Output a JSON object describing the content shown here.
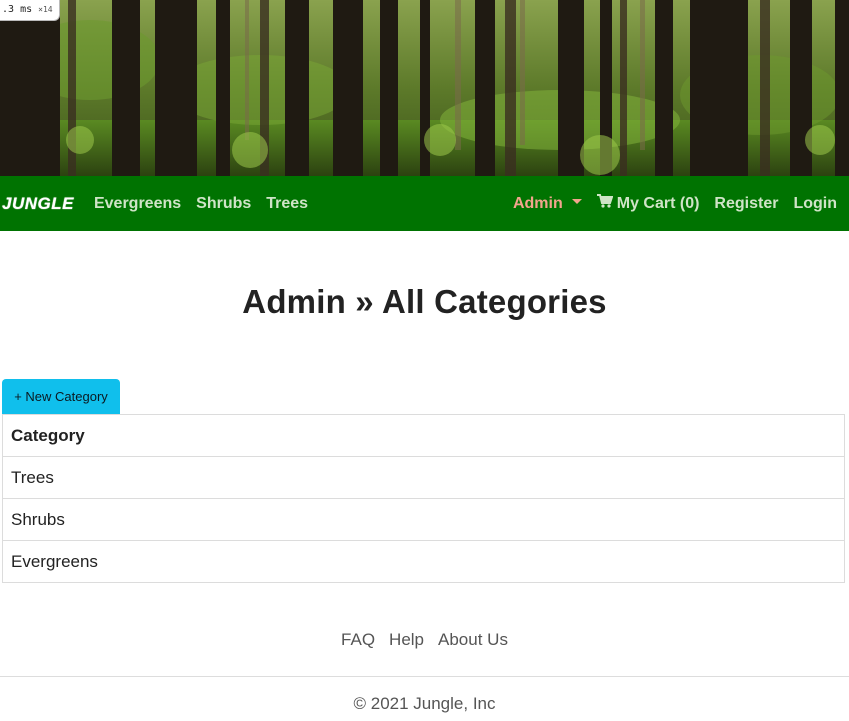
{
  "perf_badge": {
    "value": ".3",
    "unit": "ms",
    "multiplier": "×14"
  },
  "navbar": {
    "brand": "JUNGLE",
    "left_links": [
      "Evergreens",
      "Shrubs",
      "Trees"
    ],
    "admin_label": "Admin",
    "cart_label": "My Cart (0)",
    "register_label": "Register",
    "login_label": "Login"
  },
  "page": {
    "title": "Admin » All Categories",
    "new_category_button": "+ New Category"
  },
  "table": {
    "header": "Category",
    "rows": [
      "Trees",
      "Shrubs",
      "Evergreens"
    ]
  },
  "footer": {
    "links": [
      "FAQ",
      "Help",
      "About Us"
    ],
    "copyright": "© 2021 Jungle, Inc"
  },
  "colors": {
    "navbar_bg": "#007301",
    "admin_accent": "#f2a58d",
    "button_bg": "#10bfec"
  },
  "icons": {
    "cart": "shopping-cart-icon",
    "dropdown": "caret-down-icon"
  }
}
